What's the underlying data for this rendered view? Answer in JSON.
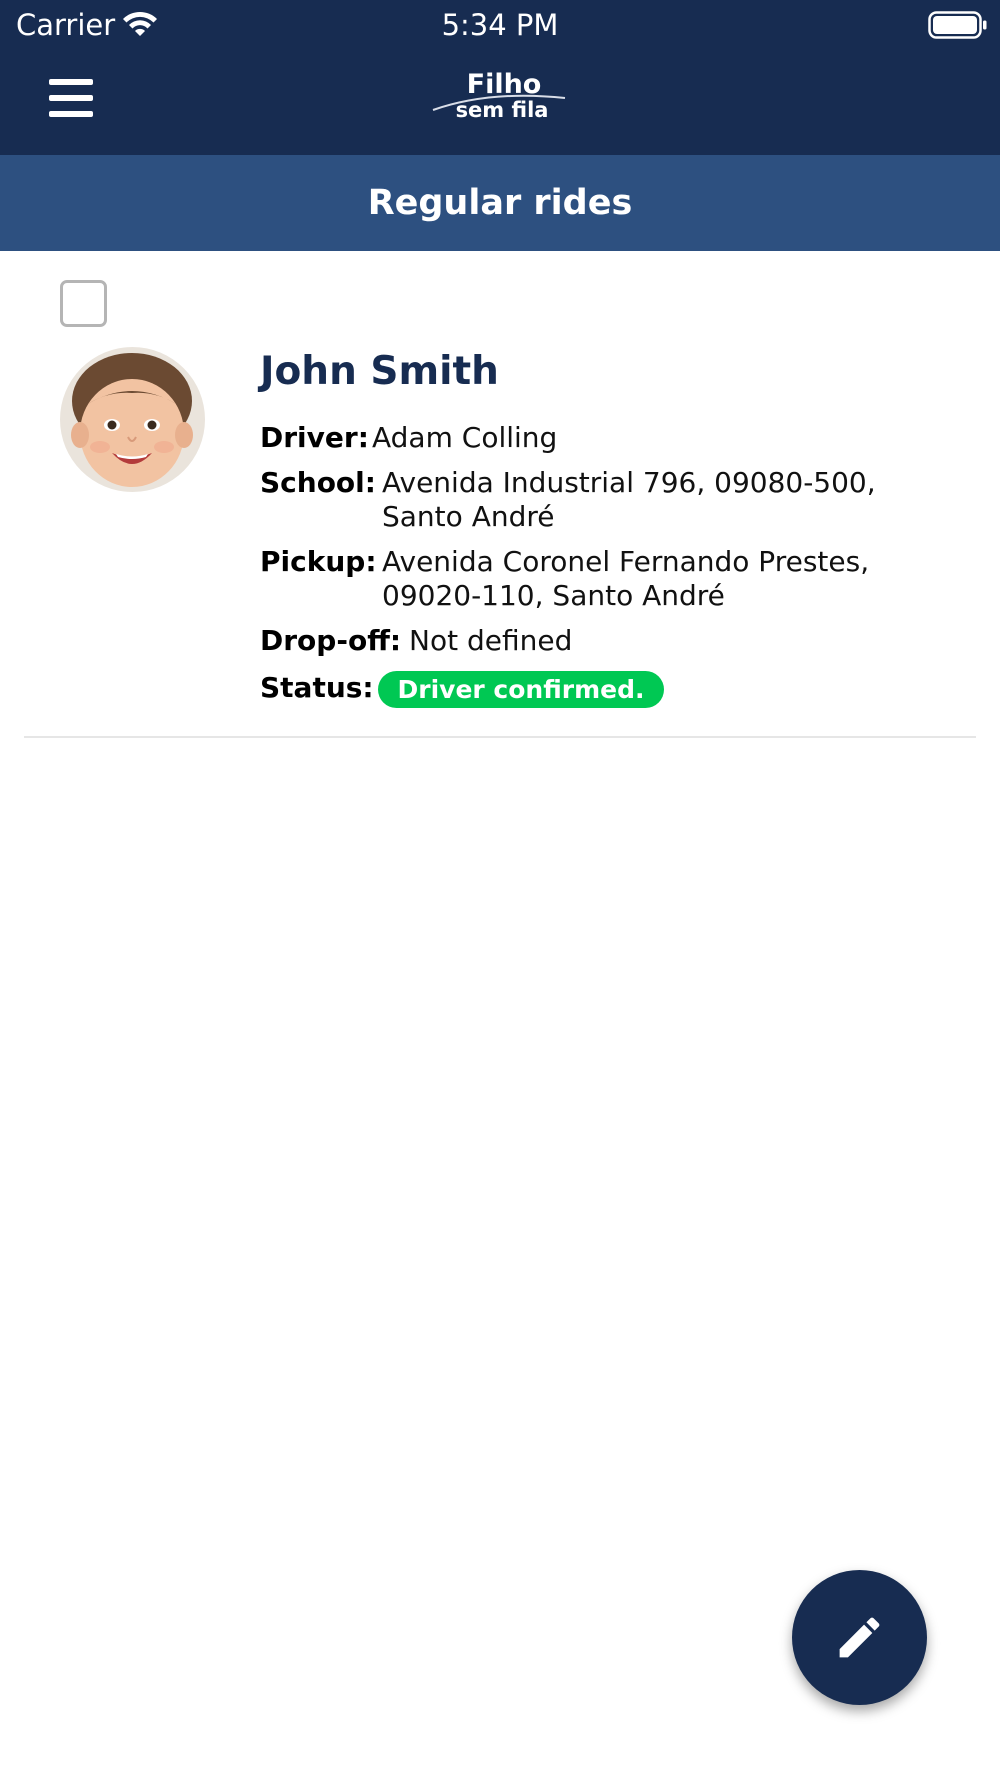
{
  "status_bar": {
    "carrier": "Carrier",
    "time": "5:34 PM",
    "wifi_icon": "wifi-icon",
    "battery_icon": "battery-icon"
  },
  "nav": {
    "menu_icon": "hamburger-menu-icon",
    "logo": {
      "line1": "Filho",
      "line2": "sem fila"
    }
  },
  "header": {
    "title": "Regular rides"
  },
  "ride": {
    "selected": false,
    "child_name": "John Smith",
    "avatar_icon": "child-photo",
    "fields": {
      "driver": {
        "label": "Driver:",
        "value": "Adam Colling"
      },
      "school": {
        "label": "School:",
        "line1": "Avenida Industrial 796, 09080-500,",
        "line2": "Santo André"
      },
      "pickup": {
        "label": "Pickup:",
        "line1": "Avenida Coronel Fernando Prestes,",
        "line2": "09020-110, Santo André"
      },
      "dropoff": {
        "label": "Drop-off:",
        "value": "Not defined"
      },
      "status": {
        "label": "Status:",
        "value": "Driver confirmed."
      }
    }
  },
  "fab": {
    "icon": "pencil-icon"
  },
  "colors": {
    "nav_bg": "#172c51",
    "header_bg": "#2d5080",
    "status_green": "#00c853",
    "name_color": "#172c51"
  }
}
